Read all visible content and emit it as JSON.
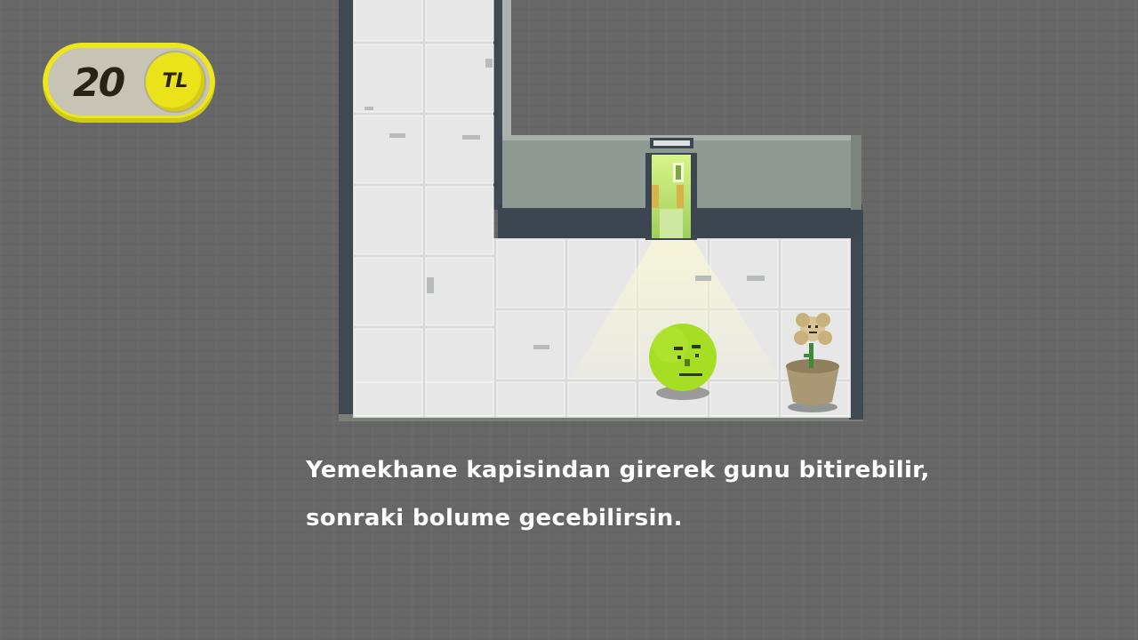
{
  "hud": {
    "amount": "20",
    "currency": "TL",
    "coin_color": "#ebe31a"
  },
  "scene": {
    "player": "green-ball-character",
    "npc": "potted-flower",
    "exit": "cafeteria-door"
  },
  "dialogue": {
    "line1": "Yemekhane kapisindan girerek gunu bitirebilir,",
    "line2": "sonraki bolume gecebilirsin."
  },
  "colors": {
    "background": "#676767",
    "floor_tile": "#e6e7e6",
    "wall": "#8f9a91",
    "player": "#a6de24",
    "door_light": "#bfee6a"
  }
}
